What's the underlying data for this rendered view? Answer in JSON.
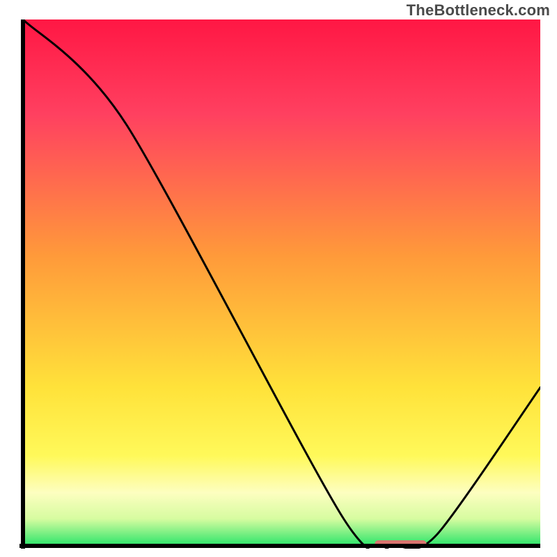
{
  "watermark": "TheBottleneck.com",
  "chart_data": {
    "type": "line",
    "title": "",
    "xlabel": "",
    "ylabel": "",
    "xlim": [
      0,
      100
    ],
    "ylim": [
      0,
      100
    ],
    "x": [
      0,
      20,
      62,
      72,
      80,
      100
    ],
    "values": [
      100,
      80,
      5,
      0,
      2,
      30
    ],
    "marker": {
      "x_start": 68,
      "x_end": 78,
      "y": 0
    },
    "gradient_stops": [
      {
        "offset": 0,
        "color": "#ff1744"
      },
      {
        "offset": 18,
        "color": "#ff4060"
      },
      {
        "offset": 45,
        "color": "#ff9a3a"
      },
      {
        "offset": 70,
        "color": "#ffe23a"
      },
      {
        "offset": 83,
        "color": "#fff95a"
      },
      {
        "offset": 90,
        "color": "#fdfec0"
      },
      {
        "offset": 95,
        "color": "#d6fca0"
      },
      {
        "offset": 100,
        "color": "#2ee56b"
      }
    ],
    "axis_color": "#000000",
    "line_color": "#000000",
    "marker_color": "#d9746f"
  }
}
